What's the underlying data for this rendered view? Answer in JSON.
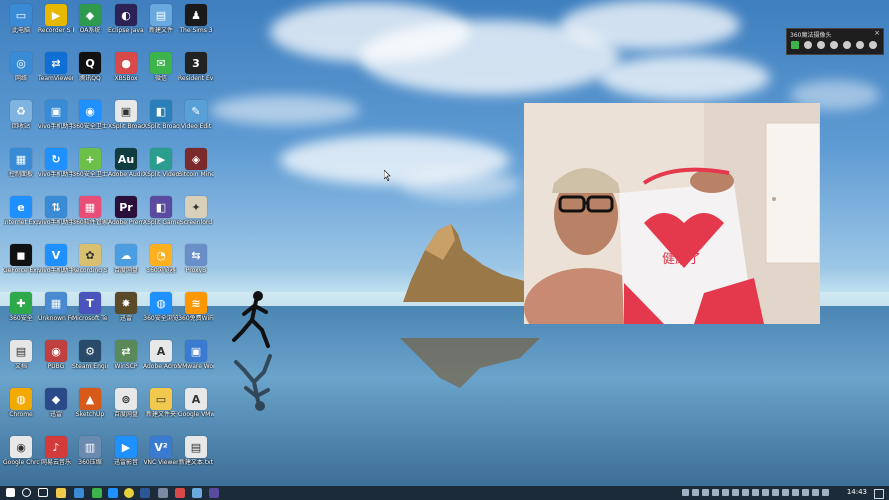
{
  "desktop_icons": [
    {
      "label": "此电脑",
      "color": "#3a8bd6",
      "glyph": "▭",
      "icon": "computer-icon"
    },
    {
      "label": "Recorder S Player",
      "color": "#e6b800",
      "glyph": "▶",
      "icon": "player-icon"
    },
    {
      "label": "OA系统",
      "color": "#2d9a4f",
      "glyph": "◆",
      "icon": "app-icon"
    },
    {
      "label": "Eclipse Java 2018-09",
      "color": "#2c2255",
      "glyph": "◐",
      "icon": "eclipse-icon"
    },
    {
      "label": "新建文件",
      "color": "#6aa9e0",
      "glyph": "▤",
      "icon": "file-icon"
    },
    {
      "label": "The Sims 3",
      "color": "#1a1a1a",
      "glyph": "♟",
      "icon": "game-icon"
    },
    {
      "label": "网络",
      "color": "#3a8bd6",
      "glyph": "◎",
      "icon": "network-icon"
    },
    {
      "label": "TeamViewer",
      "color": "#0e6fd4",
      "glyph": "⇄",
      "icon": "teamviewer-icon"
    },
    {
      "label": "腾讯QQ",
      "color": "#111111",
      "glyph": "Q",
      "icon": "qq-icon"
    },
    {
      "label": "XBSBox",
      "color": "#d84a4a",
      "glyph": "●",
      "icon": "app-icon"
    },
    {
      "label": "微信",
      "color": "#3cb44b",
      "glyph": "✉",
      "icon": "wechat-icon"
    },
    {
      "label": "Resident Evil 3",
      "color": "#222",
      "glyph": "3",
      "icon": "game-icon"
    },
    {
      "label": "回收站",
      "color": "#7fb3e0",
      "glyph": "♻",
      "icon": "recycle-bin-icon"
    },
    {
      "label": "vivo手机助手",
      "color": "#3a8bd6",
      "glyph": "▣",
      "icon": "phone-icon"
    },
    {
      "label": "360安全卫士",
      "color": "#1e90ff",
      "glyph": "◉",
      "icon": "security-icon"
    },
    {
      "label": "XSplit Broadcaster",
      "color": "#e8e8e8",
      "glyph": "▣",
      "icon": "xsplit-icon"
    },
    {
      "label": "XSplit Broadcaster",
      "color": "#2a7fb8",
      "glyph": "◧",
      "icon": "xsplit-icon"
    },
    {
      "label": "Video Edit",
      "color": "#5aa0d8",
      "glyph": "✎",
      "icon": "edit-icon"
    },
    {
      "label": "控制面板",
      "color": "#3a8bd6",
      "glyph": "▦",
      "icon": "control-panel-icon"
    },
    {
      "label": "vivo手机助手",
      "color": "#1e90ff",
      "glyph": "↻",
      "icon": "sync-icon"
    },
    {
      "label": "360安全卫士",
      "color": "#6cc04a",
      "glyph": "+",
      "icon": "security-icon"
    },
    {
      "label": "Adobe Audition",
      "color": "#103b3f",
      "glyph": "Au",
      "icon": "audition-icon"
    },
    {
      "label": "XSplit Video",
      "color": "#2a9d8f",
      "glyph": "▶",
      "icon": "video-icon"
    },
    {
      "label": "Bitcoin Miner",
      "color": "#7a2a2a",
      "glyph": "◈",
      "icon": "app-icon"
    },
    {
      "label": "Internet Explorer",
      "color": "#1e90ff",
      "glyph": "e",
      "icon": "ie-icon"
    },
    {
      "label": "vivo手机助手",
      "color": "#3a8bd6",
      "glyph": "⇅",
      "icon": "transfer-icon"
    },
    {
      "label": "360软件管家",
      "color": "#e94e77",
      "glyph": "▦",
      "icon": "store-icon"
    },
    {
      "label": "Adobe Premiere",
      "color": "#2a0f3a",
      "glyph": "Pr",
      "icon": "premiere-icon"
    },
    {
      "label": "XSplit Gamecaster",
      "color": "#5a4aa0",
      "glyph": "◧",
      "icon": "gamecaster-icon"
    },
    {
      "label": "Screenlord",
      "color": "#d8d0b8",
      "glyph": "✦",
      "icon": "app-icon"
    },
    {
      "label": "GeForce Experience",
      "color": "#111",
      "glyph": "◼",
      "icon": "nvidia-icon"
    },
    {
      "label": "vivo手机助手",
      "color": "#1e90ff",
      "glyph": "V",
      "icon": "phone-icon"
    },
    {
      "label": "Recording Software",
      "color": "#d8c070",
      "glyph": "✿",
      "icon": "app-icon"
    },
    {
      "label": "百度网盘",
      "color": "#4a9de0",
      "glyph": "☁",
      "icon": "cloud-icon"
    },
    {
      "label": "360浏览器",
      "color": "#ffb020",
      "glyph": "◔",
      "icon": "browser-icon"
    },
    {
      "label": "ProxyB",
      "color": "#6a8ec8",
      "glyph": "⇆",
      "icon": "network-icon"
    },
    {
      "label": "360安全",
      "color": "#2da84a",
      "glyph": "✚",
      "icon": "shield-icon"
    },
    {
      "label": "Unknown Folder",
      "color": "#4a8ad0",
      "glyph": "▦",
      "icon": "app-icon"
    },
    {
      "label": "Microsoft Teams",
      "color": "#4b53bc",
      "glyph": "T",
      "icon": "teams-icon"
    },
    {
      "label": "迅雷",
      "color": "#5a4a2a",
      "glyph": "✸",
      "icon": "app-icon"
    },
    {
      "label": "360安全浏览",
      "color": "#1e90ff",
      "glyph": "◍",
      "icon": "browser-icon"
    },
    {
      "label": "360免费WiFi",
      "color": "#ff9800",
      "glyph": "≋",
      "icon": "wifi-icon"
    },
    {
      "label": "文档",
      "color": "#e6e6e6",
      "glyph": "▤",
      "icon": "document-icon"
    },
    {
      "label": "PUBG",
      "color": "#c04040",
      "glyph": "◉",
      "icon": "game-icon"
    },
    {
      "label": "Steam Engine",
      "color": "#2a4a6a",
      "glyph": "⚙",
      "icon": "steam-icon"
    },
    {
      "label": "WinSCP",
      "color": "#5a8a5a",
      "glyph": "⇄",
      "icon": "winscp-icon"
    },
    {
      "label": "Adobe Acrobat",
      "color": "#e8e8e8",
      "glyph": "A",
      "icon": "acrobat-icon"
    },
    {
      "label": "VMware Workstation",
      "color": "#3a7ad0",
      "glyph": "▣",
      "icon": "vmware-icon"
    },
    {
      "label": "Chrome",
      "color": "#f2a900",
      "glyph": "◍",
      "icon": "app-icon"
    },
    {
      "label": "迅雷",
      "color": "#2a4a8a",
      "glyph": "◆",
      "icon": "app-icon"
    },
    {
      "label": "SketchUp",
      "color": "#d85a1a",
      "glyph": "▲",
      "icon": "app-icon"
    },
    {
      "label": "百度网盘",
      "color": "#e8e8e8",
      "glyph": "⊚",
      "icon": "cloud-icon"
    },
    {
      "label": "新建文件夹",
      "color": "#f2c94c",
      "glyph": "▭",
      "icon": "folder-icon"
    },
    {
      "label": "Google VMware",
      "color": "#e8e8e8",
      "glyph": "A",
      "icon": "pdf-icon"
    },
    {
      "label": "Google Chrome",
      "color": "#e8e8e8",
      "glyph": "◉",
      "icon": "chrome-icon"
    },
    {
      "label": "网易云音乐",
      "color": "#d33a3a",
      "glyph": "♪",
      "icon": "music-icon"
    },
    {
      "label": "360压缩",
      "color": "#6a8ab0",
      "glyph": "▥",
      "icon": "archive-icon"
    },
    {
      "label": "迅雷影音",
      "color": "#1e90ff",
      "glyph": "▶",
      "icon": "player-icon"
    },
    {
      "label": "VNC Viewer",
      "color": "#3a7ad0",
      "glyph": "V²",
      "icon": "vnc-icon"
    },
    {
      "label": "新建文本.txt",
      "color": "#e8e8e8",
      "glyph": "▤",
      "icon": "text-file-icon"
    }
  ],
  "webcam_window": {
    "title": "360魔法摄像头",
    "close": "×",
    "bag_text": "健康了"
  },
  "taskbar": {
    "clock": "14:43"
  }
}
